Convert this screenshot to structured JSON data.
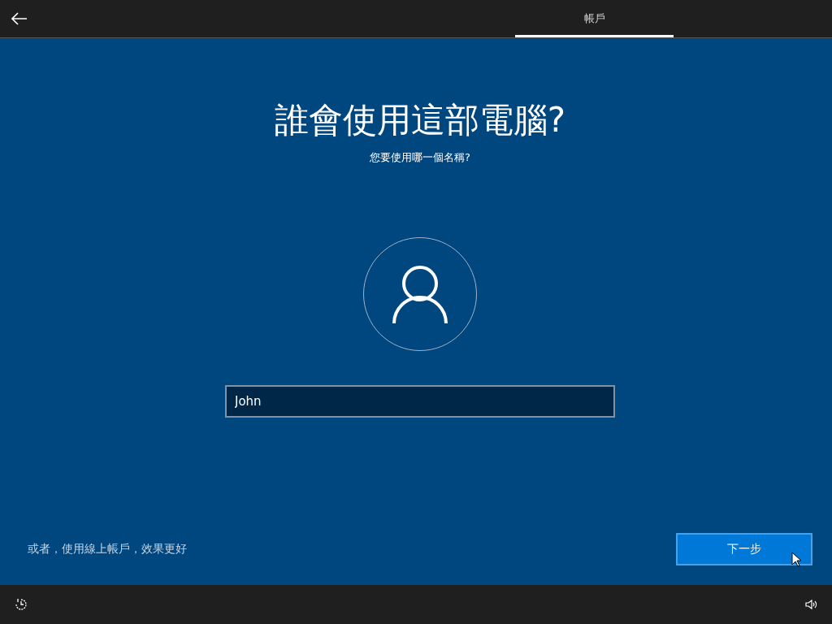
{
  "header": {
    "tabs": [
      {
        "label": "帳戶",
        "selected": true
      }
    ]
  },
  "main": {
    "title": "誰會使用這部電腦?",
    "subtitle": "您要使用哪一個名稱?",
    "name_field": {
      "value": "John"
    }
  },
  "footer": {
    "link": "或者，使用線上帳戶，效果更好",
    "button": "下一步"
  }
}
